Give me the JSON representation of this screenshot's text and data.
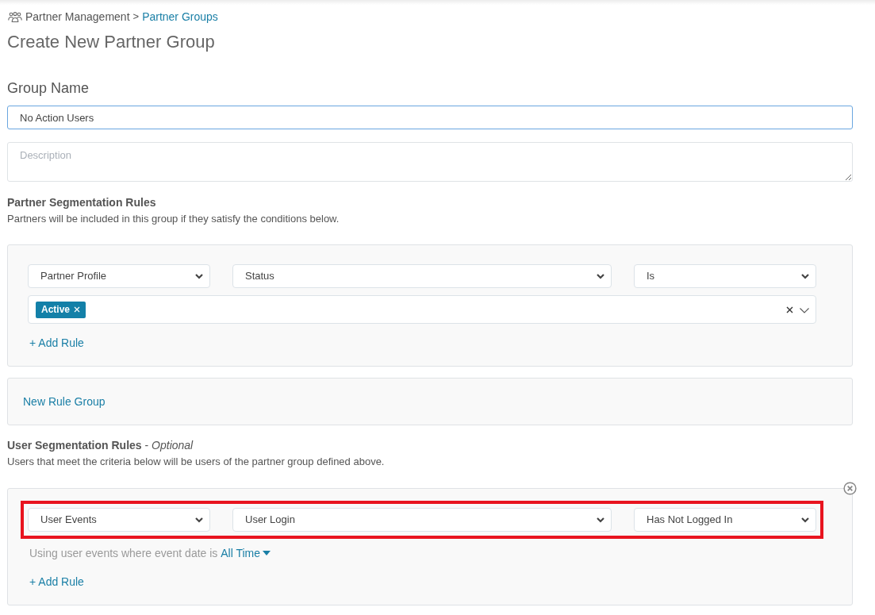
{
  "breadcrumb": {
    "items": [
      {
        "label": "Partner Management",
        "kind": "text"
      },
      {
        "label": "Partner Groups",
        "kind": "link"
      }
    ],
    "separator": ">"
  },
  "page_title": "Create New Partner Group",
  "group_name": {
    "label": "Group Name",
    "value": "No Action Users"
  },
  "description": {
    "placeholder": "Description"
  },
  "partner_segmentation": {
    "heading": "Partner Segmentation Rules",
    "subtext": "Partners will be included in this group if they satisfy the conditions below.",
    "rule_groups": [
      {
        "rules": [
          {
            "selects": [
              "Partner Profile",
              "Status",
              "Is"
            ],
            "tags": [
              {
                "label": "Active"
              }
            ]
          }
        ],
        "add_rule": "+ Add Rule"
      }
    ],
    "new_rule_group": "New Rule Group"
  },
  "user_segmentation": {
    "heading": "User Segmentation Rules",
    "note": "- *Optional*",
    "subtext": "Users that meet the criteria below will be users of the partner group defined above.",
    "rule_groups": [
      {
        "removable": true,
        "rules": [
          {
            "selects": [
              "User Events",
              "User Login",
              "Has Not Logged In"
            ],
            "highlighted": true,
            "date_filter": {
              "text": "Using user events where event date is",
              "value": "All Time"
            }
          }
        ],
        "add_rule": "+ Add Rule"
      }
    ]
  }
}
